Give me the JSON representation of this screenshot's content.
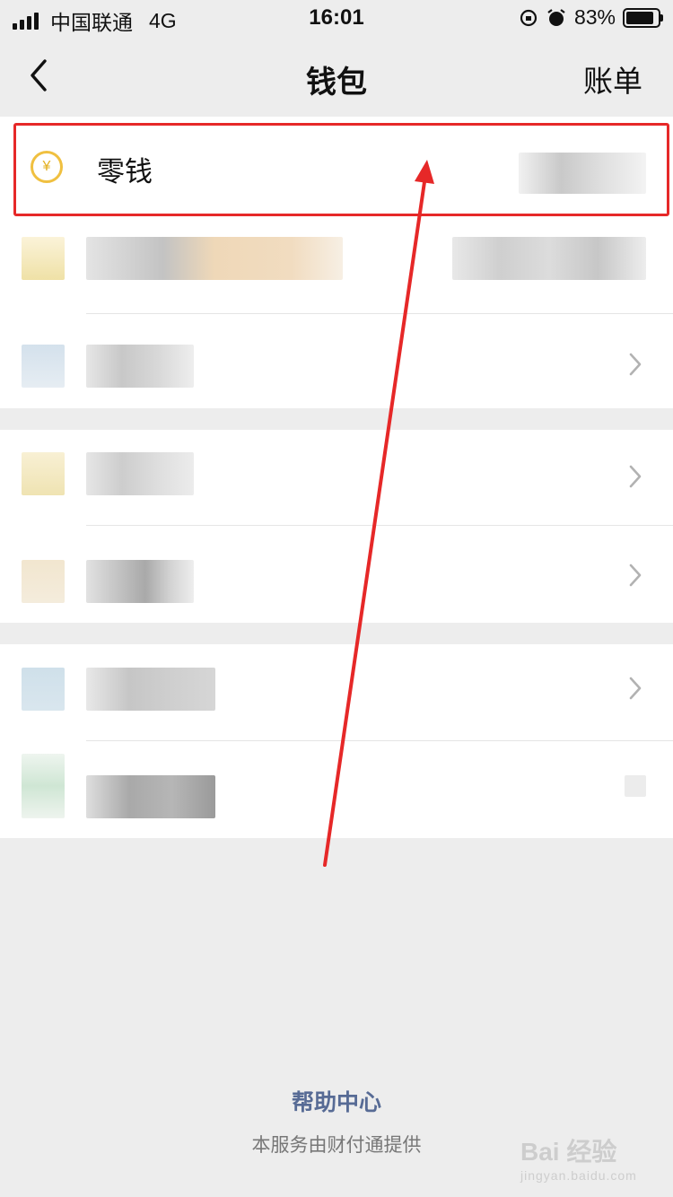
{
  "status": {
    "carrier": "中国联通",
    "network": "4G",
    "time": "16:01",
    "battery": "83%"
  },
  "nav": {
    "title": "钱包",
    "right_label": "账单"
  },
  "wallet": {
    "change_label": "零钱"
  },
  "footer": {
    "help_label": "帮助中心",
    "provider_text": "本服务由财付通提供"
  },
  "watermark": {
    "brand": "Bai 经验",
    "url": "jingyan.baidu.com"
  },
  "colors": {
    "annotation_red": "#e62828",
    "link_blue": "#576b95",
    "coin_gold": "#f0c040"
  }
}
